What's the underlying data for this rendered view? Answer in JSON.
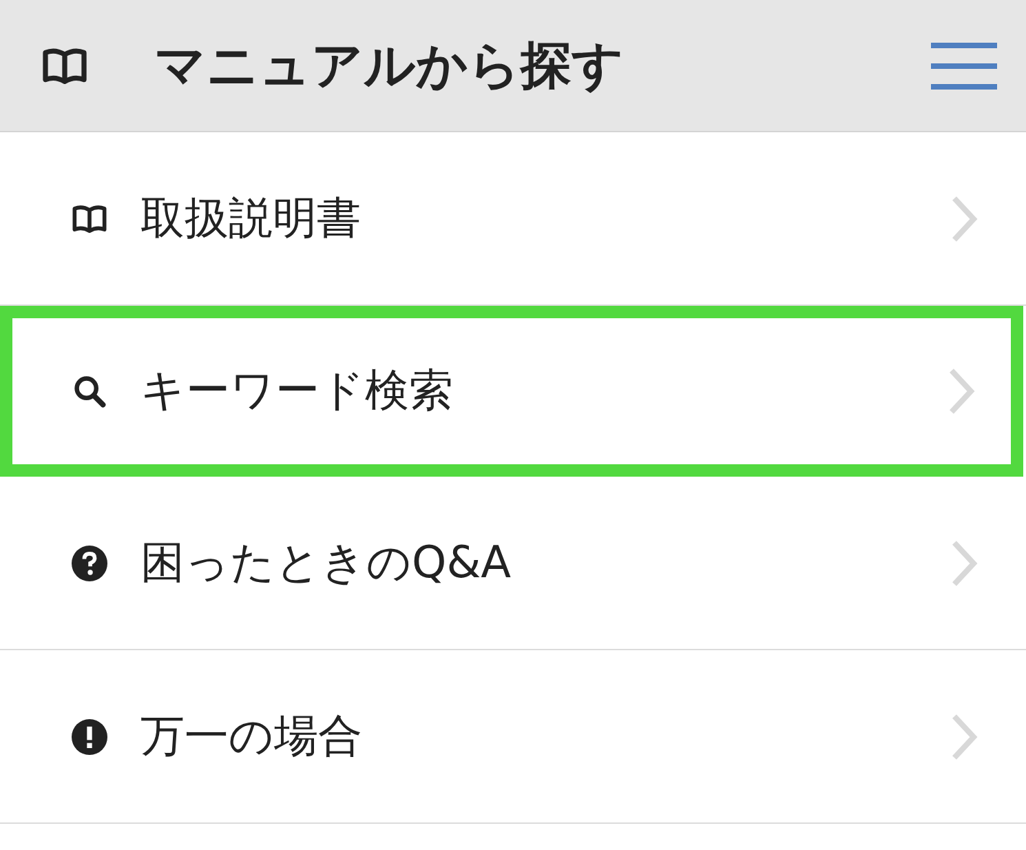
{
  "header": {
    "title": "マニュアルから探す"
  },
  "items": [
    {
      "label": "取扱説明書",
      "kind": "manual",
      "highlighted": false
    },
    {
      "label": "キーワード検索",
      "kind": "search",
      "highlighted": true
    },
    {
      "label": "困ったときのQ&A",
      "kind": "faq",
      "highlighted": false
    },
    {
      "label": "万一の場合",
      "kind": "emergency",
      "highlighted": false
    }
  ]
}
